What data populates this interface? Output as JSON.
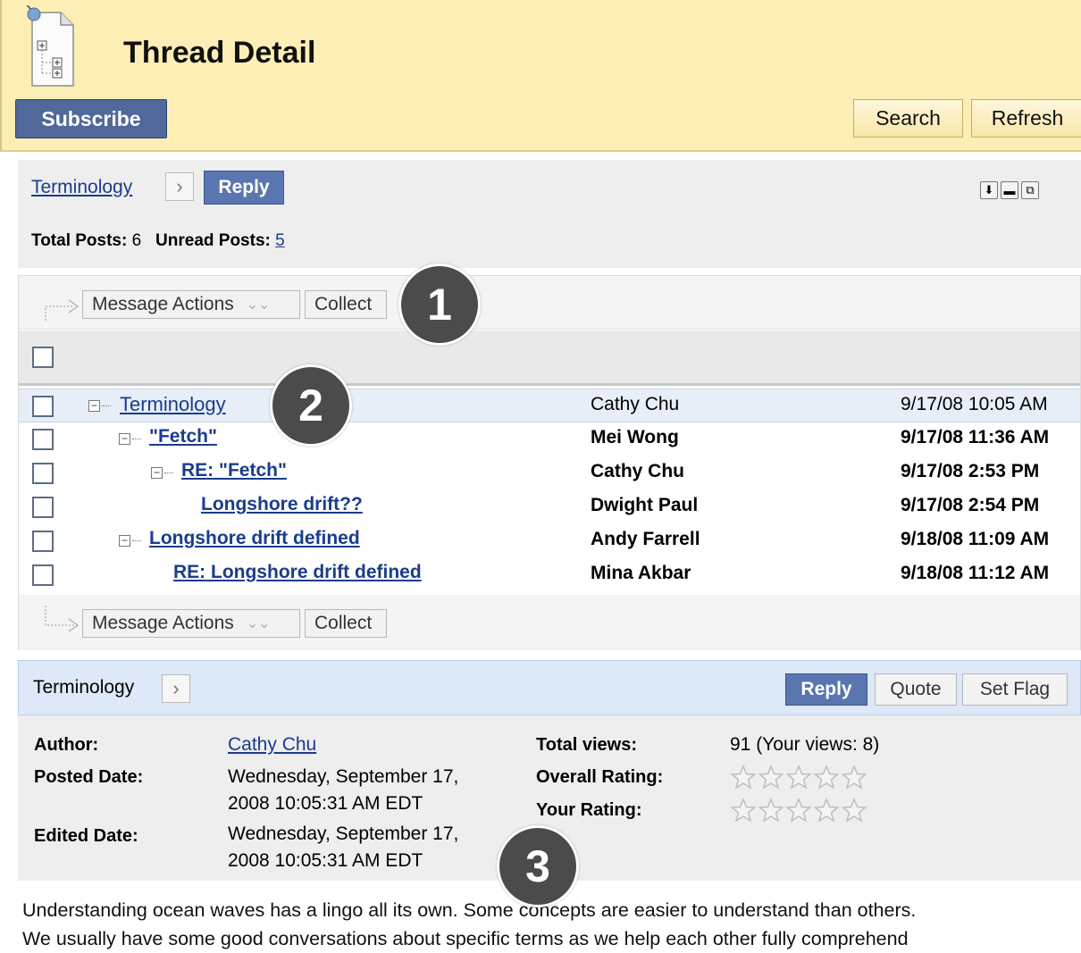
{
  "header": {
    "title": "Thread Detail",
    "subscribe_label": "Subscribe",
    "search_label": "Search",
    "refresh_label": "Refresh"
  },
  "nav": {
    "breadcrumb": "Terminology",
    "reply_label": "Reply",
    "total_posts_label": "Total Posts:",
    "total_posts_value": "6",
    "unread_posts_label": "Unread Posts:",
    "unread_posts_value": "5"
  },
  "list": {
    "message_actions_label": "Message Actions",
    "collect_label": "Collect",
    "rows": [
      {
        "subject": "Terminology",
        "author": "Cathy Chu",
        "date": "9/17/08 10:05 AM",
        "unread": false,
        "selected": true
      },
      {
        "subject": "\"Fetch\"",
        "author": "Mei Wong",
        "date": "9/17/08 11:36 AM",
        "unread": true
      },
      {
        "subject": "RE: \"Fetch\"",
        "author": "Cathy Chu",
        "date": "9/17/08 2:53 PM",
        "unread": true
      },
      {
        "subject": "Longshore drift??",
        "author": "Dwight Paul",
        "date": "9/17/08 2:54 PM",
        "unread": true
      },
      {
        "subject": "Longshore drift defined",
        "author": "Andy Farrell",
        "date": "9/18/08 11:09 AM",
        "unread": true
      },
      {
        "subject": "RE: Longshore drift defined",
        "author": "Mina Akbar",
        "date": "9/18/08 11:12 AM",
        "unread": true
      }
    ]
  },
  "detail": {
    "title": "Terminology",
    "reply_label": "Reply",
    "quote_label": "Quote",
    "set_flag_label": "Set Flag",
    "author_label": "Author:",
    "author_value": "Cathy Chu",
    "posted_label": "Posted Date:",
    "posted_line1": "Wednesday, September 17,",
    "posted_line2": "2008 10:05:31 AM EDT",
    "edited_label": "Edited Date:",
    "edited_line1": "Wednesday, September 17,",
    "edited_line2": "2008 10:05:31 AM EDT",
    "views_label": "Total views:",
    "views_value": "91 (Your views: 8)",
    "overall_rating_label": "Overall Rating:",
    "your_rating_label": "Your Rating:",
    "overall_rating": 0,
    "your_rating": 0,
    "body_line1": "Understanding ocean waves has a lingo all its own. Some concepts are easier to understand than others.",
    "body_line2": "We usually have some good conversations about specific terms as we help each other fully comprehend"
  },
  "callouts": [
    "1",
    "2",
    "3"
  ],
  "colors": {
    "header_bg": "#fdeeb5",
    "subscribe_bg": "#50689a",
    "reply_bg": "#5a76b0",
    "link": "#1a3c8c",
    "detail_bar_bg": "#dde8f8"
  }
}
